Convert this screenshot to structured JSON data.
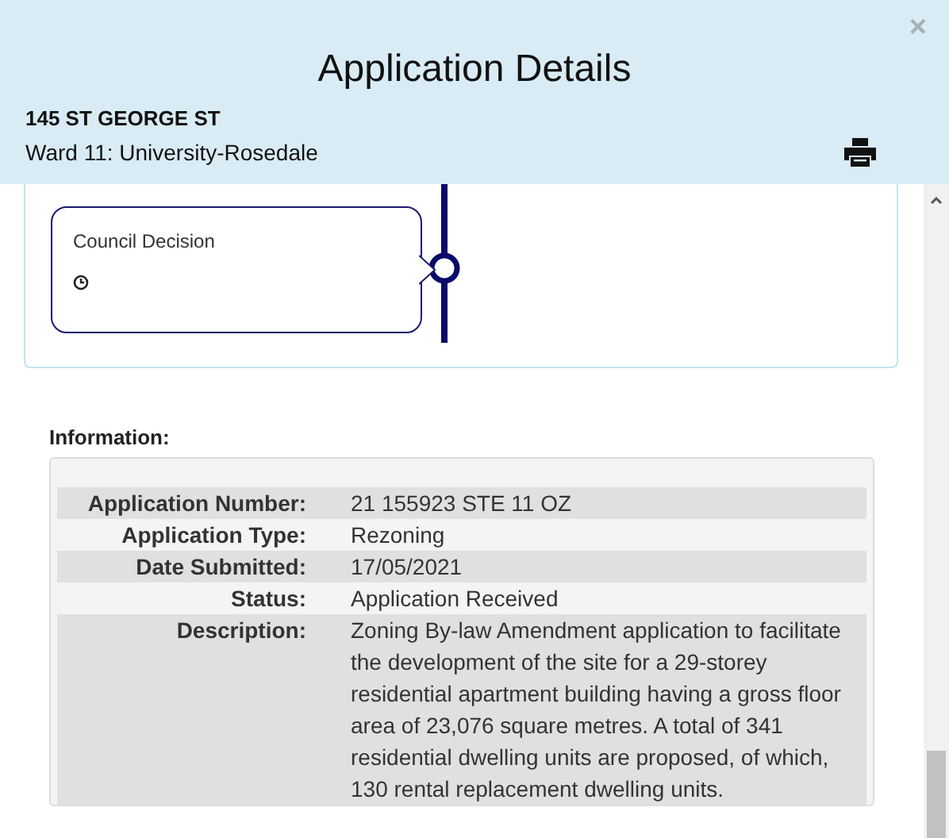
{
  "dialog": {
    "title": "Application Details",
    "close": "×",
    "address": "145 ST GEORGE ST",
    "ward": "Ward 11: University-Rosedale"
  },
  "timeline": {
    "steps": [
      {
        "label": "Council Decision"
      }
    ]
  },
  "information": {
    "heading": "Information:",
    "rows": [
      {
        "label": "Application Number:",
        "value": "21 155923 STE 11 OZ"
      },
      {
        "label": "Application Type:",
        "value": "Rezoning"
      },
      {
        "label": "Date Submitted:",
        "value": "17/05/2021"
      },
      {
        "label": "Status:",
        "value": "Application Received"
      },
      {
        "label": "Description:",
        "value": "Zoning By-law Amendment application to facilitate the development of the site for a 29-storey residential apartment building having a gross floor area of 23,076 square metres. A total of 341 residential dwelling units are proposed, of which, 130 rental replacement dwelling units."
      }
    ]
  }
}
